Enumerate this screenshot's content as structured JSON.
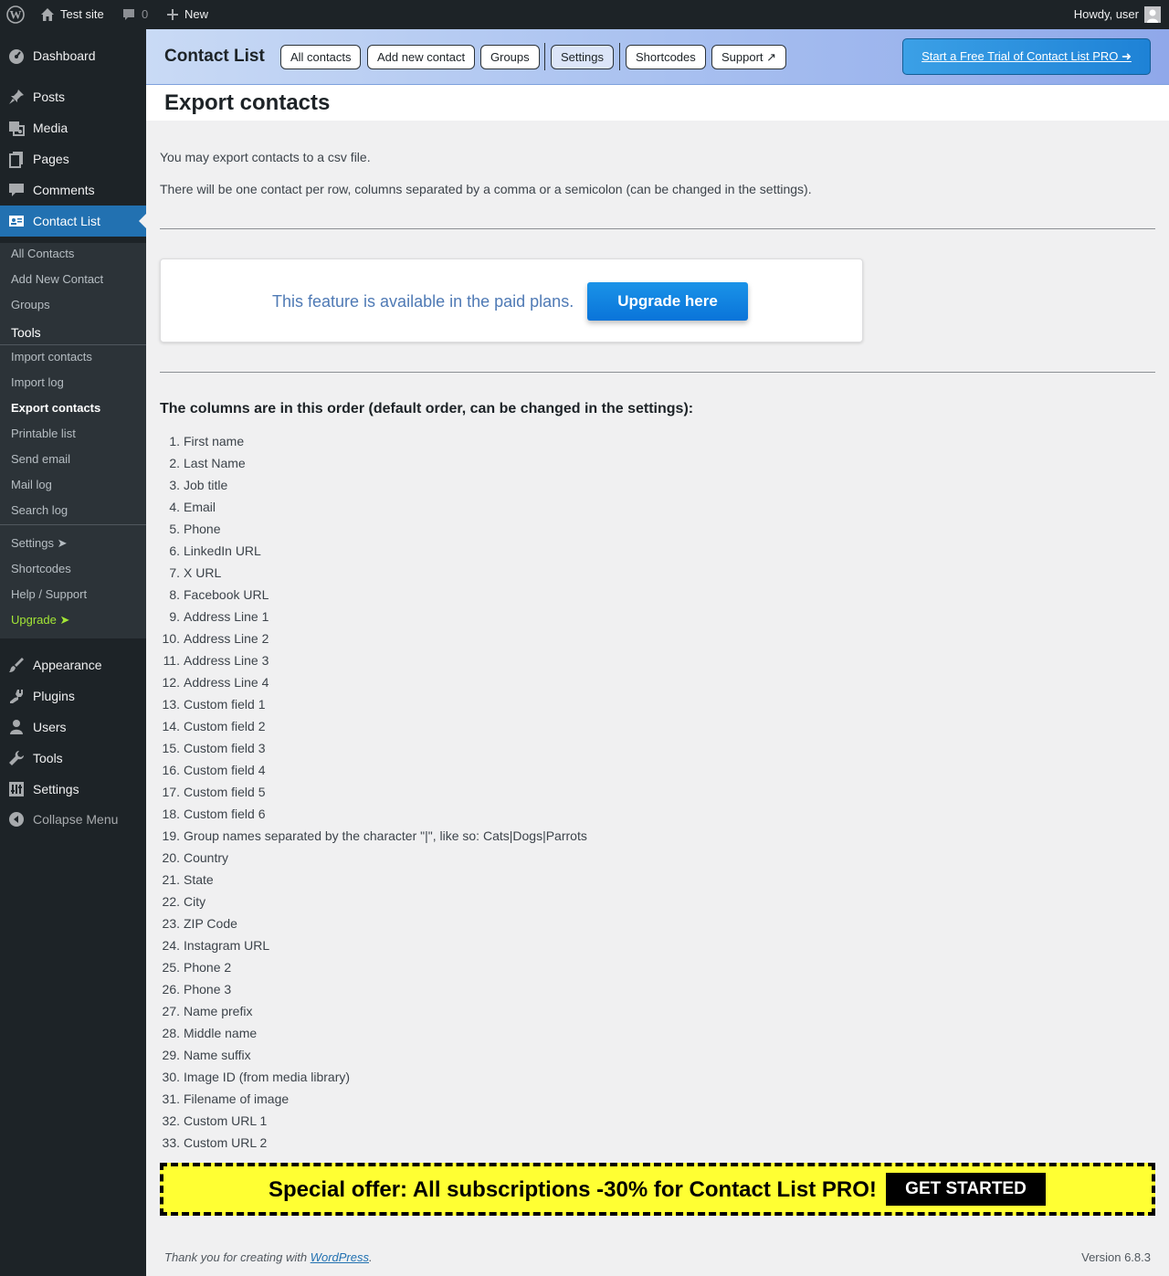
{
  "admin_bar": {
    "site_name": "Test site",
    "comments_count": "0",
    "new_label": "New",
    "howdy": "Howdy, user"
  },
  "sidebar": {
    "top_items": [
      {
        "label": "Dashboard",
        "icon": "dashboard-icon"
      },
      {
        "label": "Posts",
        "icon": "pin-icon"
      },
      {
        "label": "Media",
        "icon": "media-icon"
      },
      {
        "label": "Pages",
        "icon": "pages-icon"
      },
      {
        "label": "Comments",
        "icon": "comment-icon"
      },
      {
        "label": "Contact List",
        "icon": "contact-card-icon"
      }
    ],
    "submenu": [
      "All Contacts",
      "Add New Contact",
      "Groups",
      "Tools",
      "Import contacts",
      "Import log",
      "Export contacts",
      "Printable list",
      "Send email",
      "Mail log",
      "Search log",
      "Settings ➤",
      "Shortcodes",
      "Help / Support",
      "Upgrade ➤"
    ],
    "bottom_items": [
      {
        "label": "Appearance",
        "icon": "paintbrush-icon"
      },
      {
        "label": "Plugins",
        "icon": "plug-icon"
      },
      {
        "label": "Users",
        "icon": "user-icon"
      },
      {
        "label": "Tools",
        "icon": "wrench-icon"
      },
      {
        "label": "Settings",
        "icon": "sliders-icon"
      },
      {
        "label": "Collapse Menu",
        "icon": "collapse-icon"
      }
    ]
  },
  "plugin_header": {
    "title": "Contact List",
    "nav": [
      "All contacts",
      "Add new contact",
      "Groups",
      "Settings",
      "Shortcodes",
      "Support ↗"
    ],
    "trial_button": "Start a Free Trial of Contact List PRO ➜"
  },
  "page": {
    "title": "Export contacts",
    "intro_1": "You may export contacts to a csv file.",
    "intro_2": "There will be one contact per row, columns separated by a comma or a semicolon (can be changed in the settings).",
    "paid_notice": "This feature is available in the paid plans.",
    "upgrade_button": "Upgrade here",
    "columns_heading": "The columns are in this order (default order, can be changed in the settings):",
    "columns": [
      "First name",
      "Last Name",
      "Job title",
      "Email",
      "Phone",
      "LinkedIn URL",
      "X URL",
      "Facebook URL",
      "Address Line 1",
      "Address Line 2",
      "Address Line 3",
      "Address Line 4",
      "Custom field 1",
      "Custom field 2",
      "Custom field 3",
      "Custom field 4",
      "Custom field 5",
      "Custom field 6",
      "Group names separated by the character \"|\", like so: Cats|Dogs|Parrots",
      "Country",
      "State",
      "City",
      "ZIP Code",
      "Instagram URL",
      "Phone 2",
      "Phone 3",
      "Name prefix",
      "Middle name",
      "Name suffix",
      "Image ID (from media library)",
      "Filename of image",
      "Custom URL 1",
      "Custom URL 2"
    ]
  },
  "offer": {
    "text": "Special offer: All subscriptions -30% for Contact List PRO!",
    "button": "GET STARTED"
  },
  "footer": {
    "thanks_prefix": "Thank you for creating with ",
    "wordpress_link": "WordPress",
    "thanks_suffix": ".",
    "version": "Version 6.8.3"
  },
  "colors": {
    "sidebar_bg": "#1d2327",
    "accent": "#2271b1",
    "offer_bg": "#ffff33",
    "upgrade_green": "#a3e635"
  }
}
